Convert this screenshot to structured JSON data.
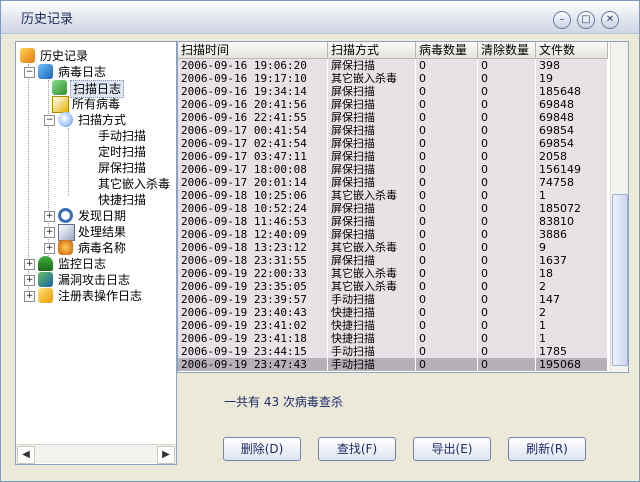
{
  "window": {
    "title": "历史记录"
  },
  "tree": {
    "root": "历史记录",
    "virus_log": "病毒日志",
    "scan_log": "扫描日志",
    "all_virus": "所有病毒",
    "scan_method": "扫描方式",
    "methods": [
      "手动扫描",
      "定时扫描",
      "屏保扫描",
      "其它嵌入杀毒",
      "快捷扫描"
    ],
    "found_date": "发现日期",
    "result": "处理结果",
    "virus_name": "病毒名称",
    "monitor_log": "监控日志",
    "vuln_log": "漏洞攻击日志",
    "registry_log": "注册表操作日志"
  },
  "table": {
    "columns": [
      "扫描时间",
      "扫描方式",
      "病毒数量",
      "清除数量",
      "文件数"
    ],
    "rows": [
      [
        "2006-09-16 19:06:20",
        "屏保扫描",
        "0",
        "0",
        "398"
      ],
      [
        "2006-09-16 19:17:10",
        "其它嵌入杀毒",
        "0",
        "0",
        "19"
      ],
      [
        "2006-09-16 19:34:14",
        "屏保扫描",
        "0",
        "0",
        "185648"
      ],
      [
        "2006-09-16 20:41:56",
        "屏保扫描",
        "0",
        "0",
        "69848"
      ],
      [
        "2006-09-16 22:41:55",
        "屏保扫描",
        "0",
        "0",
        "69848"
      ],
      [
        "2006-09-17 00:41:54",
        "屏保扫描",
        "0",
        "0",
        "69854"
      ],
      [
        "2006-09-17 02:41:54",
        "屏保扫描",
        "0",
        "0",
        "69854"
      ],
      [
        "2006-09-17 03:47:11",
        "屏保扫描",
        "0",
        "0",
        "2058"
      ],
      [
        "2006-09-17 18:00:08",
        "屏保扫描",
        "0",
        "0",
        "156149"
      ],
      [
        "2006-09-17 20:01:14",
        "屏保扫描",
        "0",
        "0",
        "74758"
      ],
      [
        "2006-09-18 10:25:06",
        "其它嵌入杀毒",
        "0",
        "0",
        "1"
      ],
      [
        "2006-09-18 10:52:24",
        "屏保扫描",
        "0",
        "0",
        "185072"
      ],
      [
        "2006-09-18 11:46:53",
        "屏保扫描",
        "0",
        "0",
        "83810"
      ],
      [
        "2006-09-18 12:40:09",
        "屏保扫描",
        "0",
        "0",
        "3886"
      ],
      [
        "2006-09-18 13:23:12",
        "其它嵌入杀毒",
        "0",
        "0",
        "9"
      ],
      [
        "2006-09-18 23:31:55",
        "屏保扫描",
        "0",
        "0",
        "1637"
      ],
      [
        "2006-09-19 22:00:33",
        "其它嵌入杀毒",
        "0",
        "0",
        "18"
      ],
      [
        "2006-09-19 23:35:05",
        "其它嵌入杀毒",
        "0",
        "0",
        "2"
      ],
      [
        "2006-09-19 23:39:57",
        "手动扫描",
        "0",
        "0",
        "147"
      ],
      [
        "2006-09-19 23:40:43",
        "快捷扫描",
        "0",
        "0",
        "2"
      ],
      [
        "2006-09-19 23:41:02",
        "快捷扫描",
        "0",
        "0",
        "1"
      ],
      [
        "2006-09-19 23:41:18",
        "快捷扫描",
        "0",
        "0",
        "1"
      ],
      [
        "2006-09-19 23:44:15",
        "手动扫描",
        "0",
        "0",
        "1785"
      ],
      [
        "2006-09-19 23:47:43",
        "手动扫描",
        "0",
        "0",
        "195068"
      ]
    ],
    "selected_index": 23
  },
  "summary": "一共有 43 次病毒查杀",
  "buttons": {
    "delete": "删除(D)",
    "find": "查找(F)",
    "export": "导出(E)",
    "refresh": "刷新(R)"
  },
  "icons": {
    "minimize": "minimize-icon",
    "maximize": "maximize-icon",
    "close": "close-icon"
  }
}
